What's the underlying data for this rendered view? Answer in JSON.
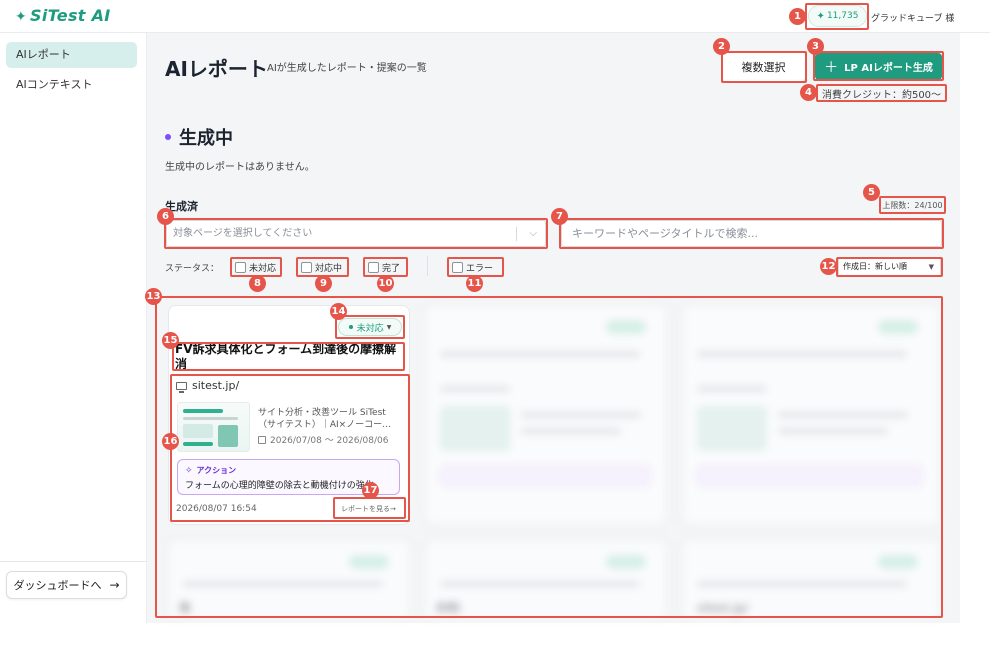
{
  "header": {
    "logo": "SiTest AI",
    "credit_balance": "11,735",
    "user_name": "グラッドキューブ 様"
  },
  "sidebar": {
    "items": [
      {
        "label": "AIレポート",
        "active": true
      },
      {
        "label": "AIコンテキスト",
        "active": false
      }
    ],
    "dashboard_button": "ダッシュボードへ"
  },
  "main": {
    "title": "AIレポート",
    "subtitle": "AIが生成したレポート・提案の一覧",
    "multi_select_label": "複数選択",
    "generate_label": "LP AIレポート生成",
    "credit_note": "消費クレジット：約500〜",
    "generating_heading": "生成中",
    "no_generating": "生成中のレポートはありません。",
    "done_heading": "生成済",
    "limit_text": "上限数：24/100",
    "filters": {
      "page_select_placeholder": "対象ページを選択してください",
      "search_placeholder": "キーワードやページタイトルで検索...",
      "status_label": "ステータス：",
      "statuses": [
        "未対応",
        "対応中",
        "完了",
        "エラー"
      ],
      "sort_value": "作成日：新しい順"
    },
    "card": {
      "status": "未対応",
      "title": "FV訴求具体化とフォーム到達後の摩擦解消",
      "site": "sitest.jp/",
      "description_line1": "サイト分析・改善ツール SiTest",
      "description_line2": "（サイテスト）｜AI×ノーコー…",
      "date_range": "2026/07/08 〜 2026/08/06",
      "action_label": "アクション",
      "action_text": "フォームの心理的障壁の除去と動機付けの強化",
      "created_at": "2026/08/07 16:54",
      "report_link": "レポートを見る→"
    },
    "blurred_fragments": [
      "策",
      "抑制",
      "sitest.jp/"
    ]
  },
  "colors": {
    "brand_green": "#1f9b80",
    "action_purple": "#6a2bd9",
    "annotation_red": "#e5554a"
  },
  "annotations": [
    "1",
    "2",
    "3",
    "4",
    "5",
    "6",
    "7",
    "8",
    "9",
    "10",
    "11",
    "12",
    "13",
    "14",
    "15",
    "16",
    "17"
  ]
}
